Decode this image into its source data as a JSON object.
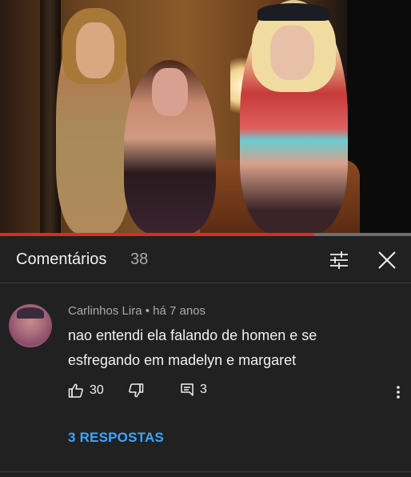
{
  "video": {
    "progress_fraction": 0.765
  },
  "header": {
    "title": "Comentários",
    "count": "38",
    "filter_icon": "filter-sliders-icon",
    "close_icon": "close-icon"
  },
  "comment": {
    "author": "Carlinhos Lira",
    "separator": " • ",
    "time": "há 7 anos",
    "text": "nao entendi ela falando de homen e se esfregando em madelyn e margaret",
    "likes": "30",
    "replies_count": "3",
    "replies_link": "3 RESPOSTAS"
  },
  "colors": {
    "background": "#212121",
    "progress_played": "#e3262e",
    "link": "#3ea6ff",
    "secondary_text": "#aaaaaa"
  }
}
